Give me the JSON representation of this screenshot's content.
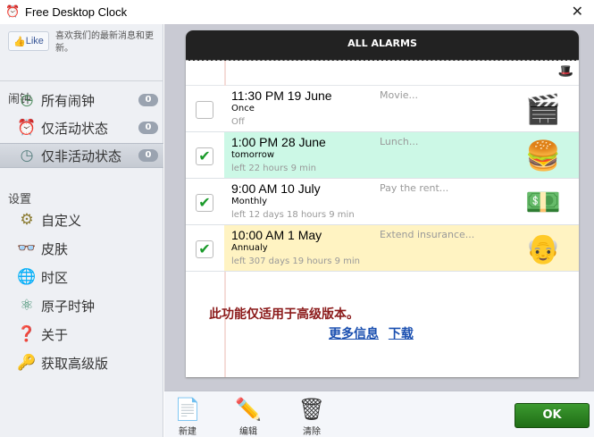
{
  "window": {
    "title": "Free Desktop Clock",
    "close": "✕"
  },
  "sidebar": {
    "like_button": "Like",
    "like_text": "喜欢我们的最新消息和更新。",
    "alarms_section": "闹钟",
    "alarm_items": [
      {
        "label": "所有闹钟",
        "count": "0"
      },
      {
        "label": "仅活动状态",
        "count": "0"
      },
      {
        "label": "仅非活动状态",
        "count": "0"
      }
    ],
    "settings_section": "设置",
    "settings_items": [
      {
        "label": "自定义"
      },
      {
        "label": "皮肤"
      },
      {
        "label": "时区"
      },
      {
        "label": "原子时钟"
      },
      {
        "label": "关于"
      },
      {
        "label": "获取高级版"
      }
    ]
  },
  "main": {
    "header": "ALL ALARMS",
    "alarms": [
      {
        "time": "11:30 PM  19 June",
        "repeat": "Once",
        "left": "Off",
        "note": "Movie...",
        "checked": false,
        "color": "#ffffff"
      },
      {
        "time": "1:00 PM  28 June",
        "repeat": "tomorrow",
        "left": "left 22 hours 9 min",
        "note": "Lunch...",
        "checked": true,
        "color": "#ccf8e6"
      },
      {
        "time": "9:00 AM  10 July",
        "repeat": "Monthly",
        "left": "left 12 days 18 hours 9 min",
        "note": "Pay the rent...",
        "checked": true,
        "color": "#ffffff"
      },
      {
        "time": "10:00 AM  1 May",
        "repeat": "Annualy",
        "left": "left 307 days 19 hours 9 min",
        "note": "Extend insurance...",
        "checked": true,
        "color": "#fff3c2"
      }
    ],
    "premium_notice": "此功能仅适用于高级版本。",
    "more_info": "更多信息",
    "download": "下载"
  },
  "toolbar": {
    "new": "新建",
    "edit": "编辑",
    "clear": "清除",
    "ok": "OK"
  }
}
